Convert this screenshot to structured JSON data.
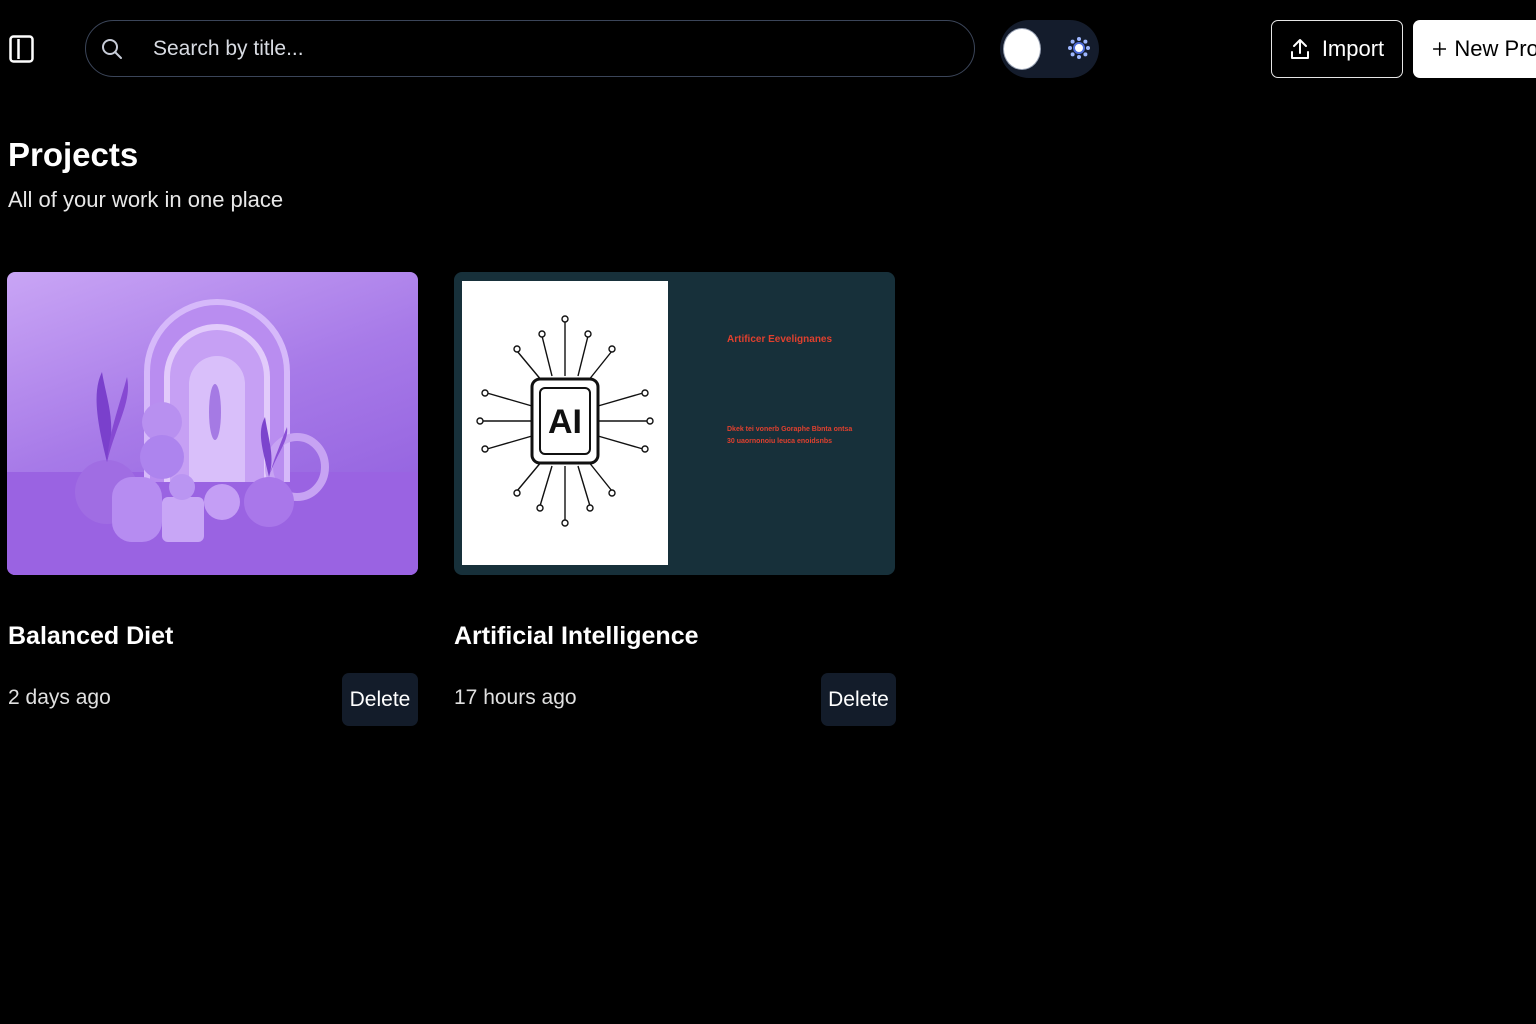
{
  "toolbar": {
    "search_placeholder": "Search by title...",
    "import_label": "Import",
    "new_project_label": "New Project"
  },
  "header": {
    "title": "Projects",
    "subtitle": "All of your work in one place"
  },
  "projects": [
    {
      "title": "Balanced Diet",
      "time": "2 days ago",
      "delete_label": "Delete",
      "thumbnail": "purple-3d-vases-scene"
    },
    {
      "title": "Artificial Intelligence",
      "time": "17 hours ago",
      "delete_label": "Delete",
      "thumbnail": "ai-chip-slide",
      "slide_heading": "Artificer Eevelignanes",
      "slide_body": "Dkek tei vonerb Goraphe Bbnta ontsa 30 uaornonoiu leuca enoidsnbs",
      "slide_chip_label": "AI"
    }
  ],
  "colors": {
    "background": "#000000",
    "card_dark": "#17303a",
    "button_dark": "#131c2a",
    "accent_purple": "#a77ae8",
    "slide_text": "#e0402e"
  }
}
